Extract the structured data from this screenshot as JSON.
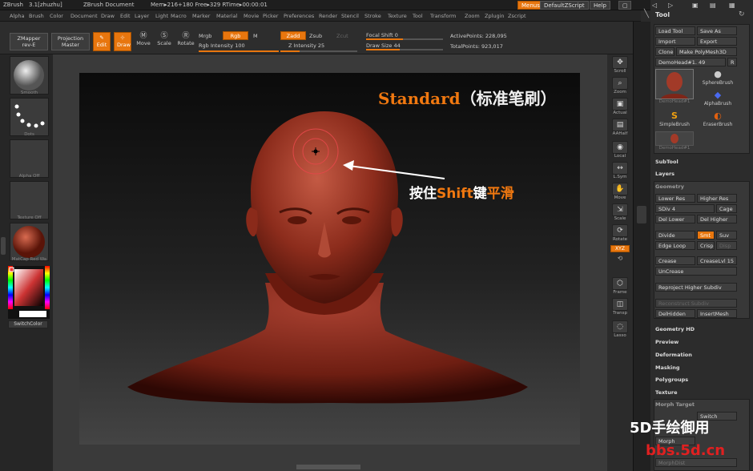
{
  "titlebar": {
    "app": "ZBrush",
    "version": "3.1[zhuzhu]",
    "document": "ZBrush Document",
    "mem": "Mem▸216+180 Free▸329 RTime▸00:00:01",
    "menus_button": "Menus",
    "script_button": "DefaultZScript",
    "help_button": "Help"
  },
  "menubar": {
    "items": [
      "Alpha",
      "Brush",
      "Color",
      "Document",
      "Draw",
      "Edit",
      "Layer",
      "Light",
      "Macro",
      "Marker",
      "Material",
      "Movie",
      "Picker",
      "Preferences",
      "Render",
      "Stencil",
      "Stroke",
      "Texture",
      "Tool",
      "Transform",
      "Zoom",
      "Zplugin",
      "Zscript"
    ]
  },
  "toolbar": {
    "zmapper": "ZMapper",
    "zmapper_sub": "rev-E",
    "projection": "Projection",
    "projection_sub": "Master",
    "edit": "Edit",
    "draw": "Draw",
    "move": "Move",
    "scale": "Scale",
    "rotate": "Rotate",
    "mrgb": "Mrgb",
    "rgb": "Rgb",
    "m": "M",
    "rgb_intensity": "Rgb Intensity 100",
    "rgb_intensity_value": 100,
    "zadd": "Zadd",
    "zsub": "Zsub",
    "zcut": "Zcut",
    "z_intensity": "Z Intensity 25",
    "z_intensity_value": 25,
    "focal_shift": "Focal Shift 0",
    "draw_size": "Draw Size 44",
    "draw_size_value": 44,
    "active_points": "ActivePoints: 228,095",
    "total_points": "TotalPoints: 923,017"
  },
  "leftshelf": {
    "smooth": "Smooth",
    "dots": "Dots",
    "alpha": "Alpha  Off",
    "texture": "Texture  Off",
    "matcap": "MatCap Red Wa",
    "switch_color": "SwitchColor"
  },
  "rightshelf": {
    "scroll": "Scroll",
    "zoom": "Zoom",
    "actual": "Actual",
    "aahalf": "AAHalf",
    "local": "Local",
    "lsym": "L.Sym",
    "move": "Move",
    "scale": "Scale",
    "rotate": "Rotate",
    "xyz": "XYZ",
    "frame": "Frame",
    "transp": "Transp",
    "lasso": "Lasso"
  },
  "toolpanel": {
    "title": "Tool",
    "load_tool": "Load Tool",
    "save_as": "Save As",
    "import": "Import",
    "export": "Export",
    "clone": "Clone",
    "make_polymesh": "Make PolyMesh3D",
    "current_tool": "DemoHead#1. 49",
    "r": "R",
    "brushes": [
      "DemoHead#1",
      "SphereBrush",
      "AlphaBrush",
      "SimpleBrush",
      "EraserBrush",
      "DemoHead#1"
    ],
    "subtool": "SubTool",
    "layers": "Layers",
    "geometry": "Geometry",
    "lower_res": "Lower Res",
    "higher_res": "Higher Res",
    "sdiv": "SDiv 4",
    "cage": "Cage",
    "del_lower": "Del Lower",
    "del_higher": "Del Higher",
    "divide": "Divide",
    "smt": "Smt",
    "suv": "Suv",
    "edge_loop": "Edge Loop",
    "crisp": "Crisp",
    "disp": "Disp",
    "crease": "Crease",
    "crease_lvl": "CreaseLvl 15",
    "uncrease": "UnCrease",
    "reproject": "Reproject Higher Subdiv",
    "reconstruct": "Reconstruct Subdiv",
    "del_hidden": "DelHidden",
    "insert_mesh": "InsertMesh",
    "geometry_hd": "Geometry HD",
    "preview": "Preview",
    "deformation": "Deformation",
    "masking": "Masking",
    "polygroups": "Polygroups",
    "texture": "Texture",
    "morph_target": "Morph Target",
    "switch": "Switch",
    "morph": "Morph",
    "morph_dist": "MorphDist"
  },
  "overlay": {
    "title_en": "Standard",
    "title_zh": "（标准笔刷）",
    "note_a": "按住",
    "note_b": "Shift",
    "note_c": "键",
    "note_d": "平滑"
  },
  "watermark": {
    "line1": "5D手绘御用",
    "line2": "bbs.5d.cn"
  },
  "colors": {
    "accent": "#e8760e",
    "clay": "#a8402f"
  }
}
